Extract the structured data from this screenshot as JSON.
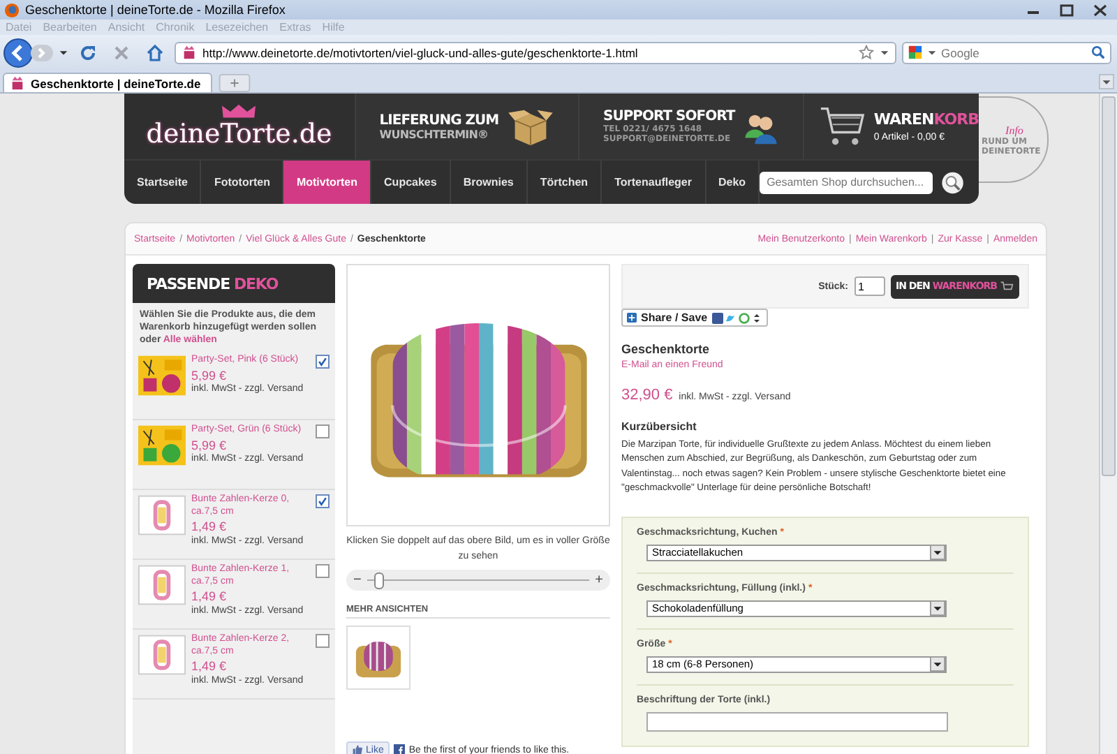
{
  "browser": {
    "title": "Geschenktorte | deineTorte.de - Mozilla Firefox",
    "menu": [
      "Datei",
      "Bearbeiten",
      "Ansicht",
      "Chronik",
      "Lesezeichen",
      "Extras",
      "Hilfe"
    ],
    "url": "http://www.deinetorte.de/motivtorten/viel-gluck-und-alles-gute/geschenktorte-1.html",
    "search_placeholder": "Google",
    "tabs": [
      {
        "label": "Geschenktorte | deineTorte.de",
        "selected": true
      }
    ]
  },
  "header": {
    "logo": "deineTorte.de",
    "delivery": [
      "LIEFERUNG ZUM",
      "WUNSCHTERMIN®"
    ],
    "support": {
      "title": "SUPPORT SOFORT",
      "phone": "TEL 0221/ 4675 1648",
      "email": "SUPPORT@DEINETORTE.DE"
    },
    "cart": {
      "title_a": "WAREN",
      "title_b": "KORB",
      "summary": "0 Artikel - 0,00 €"
    },
    "info": {
      "label": "Info",
      "lines": [
        "RUND UM",
        "DEINETORTE"
      ]
    }
  },
  "nav": {
    "items": [
      {
        "label": "Startseite",
        "selected": false
      },
      {
        "label": "Fototorten",
        "selected": false
      },
      {
        "label": "Motivtorten",
        "selected": true
      },
      {
        "label": "Cupcakes",
        "selected": false
      },
      {
        "label": "Brownies",
        "selected": false
      },
      {
        "label": "Törtchen",
        "selected": false
      },
      {
        "label": "Tortenaufleger",
        "selected": false
      },
      {
        "label": "Deko",
        "selected": false
      }
    ],
    "search_placeholder": "Gesamten Shop durchsuchen..."
  },
  "breadcrumb": {
    "links": [
      "Startseite",
      "Motivtorten",
      "Viel Glück & Alles Gute"
    ],
    "separator": "/",
    "current": "Geschenktorte"
  },
  "account_links": [
    "Mein Benutzerkonto",
    "Mein Warenkorb",
    "Zur Kasse",
    "Anmelden"
  ],
  "account_separator": "|",
  "sidebar": {
    "title_a": "PASSENDE",
    "title_b": "DEKO",
    "intro": "Wählen Sie die Produkte aus, die dem Warenkorb hinzugefügt werden sollen oder",
    "select_all": "Alle wählen",
    "items": [
      {
        "kind": "party-set",
        "color": "#c0306a",
        "name": "Party-Set, Pink (6 Stück)",
        "price": "5,99 €",
        "tax": "inkl. MwSt - zzgl. Versand",
        "checked": true
      },
      {
        "kind": "party-set",
        "color": "#3aa83a",
        "name": "Party-Set, Grün (6 Stück)",
        "price": "5,99 €",
        "tax": "inkl. MwSt - zzgl. Versand",
        "checked": false
      },
      {
        "kind": "candle",
        "name": "Bunte Zahlen-Kerze 0, ca.7,5 cm",
        "price": "1,49 €",
        "tax": "inkl. MwSt - zzgl. Versand",
        "checked": true
      },
      {
        "kind": "candle",
        "name": "Bunte Zahlen-Kerze 1, ca.7,5 cm",
        "price": "1,49 €",
        "tax": "inkl. MwSt - zzgl. Versand",
        "checked": false
      },
      {
        "kind": "candle",
        "name": "Bunte Zahlen-Kerze 2, ca.7,5 cm",
        "price": "1,49 €",
        "tax": "inkl. MwSt - zzgl. Versand",
        "checked": false
      }
    ]
  },
  "gallery": {
    "caption": "Klicken Sie doppelt auf das obere Bild, um es in voller Größe zu sehen",
    "zoom": {
      "minus": "−",
      "plus": "+",
      "level": 0.03
    },
    "more_views": "MEHR ANSICHTEN",
    "like_button": "Like",
    "like_text": "Be the first of your friends to like this."
  },
  "product": {
    "qty_label": "Stück:",
    "qty": "1",
    "cart_button_a": "IN DEN",
    "cart_button_b": "WARENKORB",
    "share": "Share / Save",
    "name": "Geschenktorte",
    "email_link": "E-Mail an einen Freund",
    "price": "32,90 €",
    "tax": "inkl. MwSt - zzgl. Versand",
    "summary_title": "Kurzübersicht",
    "description": "Die Marzipan Torte, für individuelle Grußtexte zu jedem Anlass. Möchtest du einem lieben Menschen zum Abschied, zur Begrüßung, als Dankeschön, zum Geburtstag oder zum Valentinstag... noch etwas sagen? Kein Problem - unsere stylische Geschenktorte bietet eine \"geschmackvolle\" Unterlage für deine persönliche Botschaft!",
    "options": [
      {
        "kind": "select",
        "label": "Geschmacksrichtung, Kuchen",
        "mark": "*",
        "value": "Stracciatellakuchen"
      },
      {
        "kind": "select",
        "label": "Geschmacksrichtung, Füllung (inkl.)",
        "mark": "*",
        "value": "Schokoladenfüllung"
      },
      {
        "kind": "select",
        "label": "Größe",
        "mark": "*",
        "value": "18 cm (6-8 Personen)"
      },
      {
        "kind": "text",
        "label": "Beschriftung der Torte (inkl.)"
      }
    ]
  }
}
